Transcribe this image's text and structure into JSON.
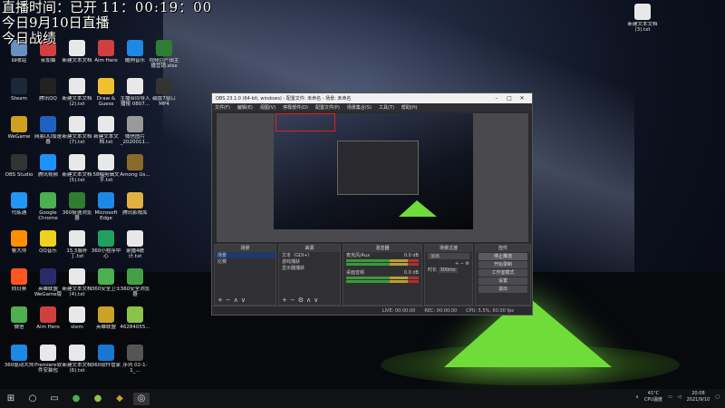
{
  "overlay": {
    "line1": "直播时间：已开",
    "clock": "11：00:19：00",
    "line2": "今日9月10日直播",
    "line3": "今日战绩"
  },
  "desktop_icons": [
    {
      "label": "回收站",
      "color": "#6a8fc0"
    },
    {
      "label": "亲加猫",
      "color": "#d04040"
    },
    {
      "label": "新建文本文档",
      "color": "#e8e8e8"
    },
    {
      "label": "Aim Hero",
      "color": "#d04040"
    },
    {
      "label": "酷狗音乐",
      "color": "#1e88e5"
    },
    {
      "label": "视频巨产出主播营销.xlsx",
      "color": "#2e7d32"
    },
    {
      "label": "Steam",
      "color": "#1b2838"
    },
    {
      "label": "腾讯QQ",
      "color": "#222"
    },
    {
      "label": "新建文本文档(2).txt",
      "color": "#e8e8e8"
    },
    {
      "label": "Draw & Guess",
      "color": "#f0c030"
    },
    {
      "label": "主播合同导入 播报 0807...",
      "color": "#e8e8e8"
    },
    {
      "label": "磁盘7窗口 MP4",
      "color": "#333"
    },
    {
      "label": "WeGame",
      "color": "#d0a020"
    },
    {
      "label": "网易UU加速器",
      "color": "#2060c0"
    },
    {
      "label": "新建文本文档(7).txt",
      "color": "#e8e8e8"
    },
    {
      "label": "新建文本文档.txt",
      "color": "#e8e8e8"
    },
    {
      "label": "微信图片_2020011...",
      "color": "#999"
    },
    {
      "label": "OBS Studio",
      "color": "#333"
    },
    {
      "label": "腾讯视频",
      "color": "#1e90ff"
    },
    {
      "label": "新建文本文档(5).txt",
      "color": "#e8e8e8"
    },
    {
      "label": "58幅剪辑文字.txt",
      "color": "#e8e8e8"
    },
    {
      "label": "Among Us...",
      "color": "#8a6a2a"
    },
    {
      "label": "代练通",
      "color": "#2196f3"
    },
    {
      "label": "Google Chrome",
      "color": "#4caf50"
    },
    {
      "label": "360极速浏览器",
      "color": "#2e7d32"
    },
    {
      "label": "Microsoft Edge",
      "color": "#1e88e5"
    },
    {
      "label": "腾讯影视库",
      "color": "#e0b040"
    },
    {
      "label": "鲁大师",
      "color": "#ff8f00"
    },
    {
      "label": "QQ音乐",
      "color": "#f0d020"
    },
    {
      "label": "15.5服补丁.txt",
      "color": "#e8e8e8"
    },
    {
      "label": "360小程序中心",
      "color": "#20a060"
    },
    {
      "label": "录播4统计.txt",
      "color": "#e8e8e8"
    },
    {
      "label": "向日葵",
      "color": "#ff5722"
    },
    {
      "label": "英雄联盟WeGame版",
      "color": "#2a2a6a"
    },
    {
      "label": "新建文本文档(4).txt",
      "color": "#e8e8e8"
    },
    {
      "label": "360安全卫士",
      "color": "#4caf50"
    },
    {
      "label": "360安全浏览器",
      "color": "#43a047"
    },
    {
      "label": "微信",
      "color": "#4caf50"
    },
    {
      "label": "Aim Hero",
      "color": "#d04040"
    },
    {
      "label": "stem",
      "color": "#e8e8e8"
    },
    {
      "label": "英雄联盟",
      "color": "#c9a227"
    },
    {
      "label": "46284055...",
      "color": "#8bc34a"
    },
    {
      "label": "360驱动大师",
      "color": "#1e88e5"
    },
    {
      "label": "Premiere软件安装包",
      "color": "#e8e8e8"
    },
    {
      "label": "新建文本文档(6).txt",
      "color": "#e8e8e8"
    },
    {
      "label": "360软件管家",
      "color": "#1976d2"
    },
    {
      "label": "序列 02-1-1_...",
      "color": "#555"
    },
    {
      "label": "新建文本文档(3).txt",
      "color": "#e8e8e8"
    }
  ],
  "obs": {
    "title": "OBS 23.1.0 (64-bit, windows) - 配置文件: 未命名 - 场景: 未命名",
    "menus": [
      "文件(F)",
      "编辑(E)",
      "视图(V)",
      "停靠部件(D)",
      "配置文件(P)",
      "场景集合(S)",
      "工具(T)",
      "帮助(H)"
    ],
    "docks": {
      "scenes": {
        "title": "场景",
        "items": [
          "场景",
          "比赛"
        ]
      },
      "sources": {
        "title": "来源",
        "items": [
          "文本（GDI+）",
          "游戏捕获",
          "显示器捕获"
        ]
      },
      "mixer": {
        "title": "混音器",
        "channels": [
          "麦克风/Aux",
          "桌面音频"
        ],
        "levels": [
          "0.0 dB",
          "0.0 dB"
        ]
      },
      "transitions": {
        "title": "场景过渡",
        "type": "淡出",
        "duration_label": "时长",
        "duration": "300ms"
      },
      "controls": {
        "title": "控件",
        "buttons": [
          "停止推流",
          "开始录制",
          "工作室模式",
          "设置",
          "退出"
        ]
      }
    },
    "status": {
      "live": "LIVE: 00:00:00",
      "rec": "REC: 00:00:00",
      "cpu": "CPU: 5.5%, 60.00 fps"
    }
  },
  "taskbar": {
    "temp": "41°C",
    "temp_label": "CPU温度",
    "time": "20:08",
    "date": "2021/9/10"
  }
}
